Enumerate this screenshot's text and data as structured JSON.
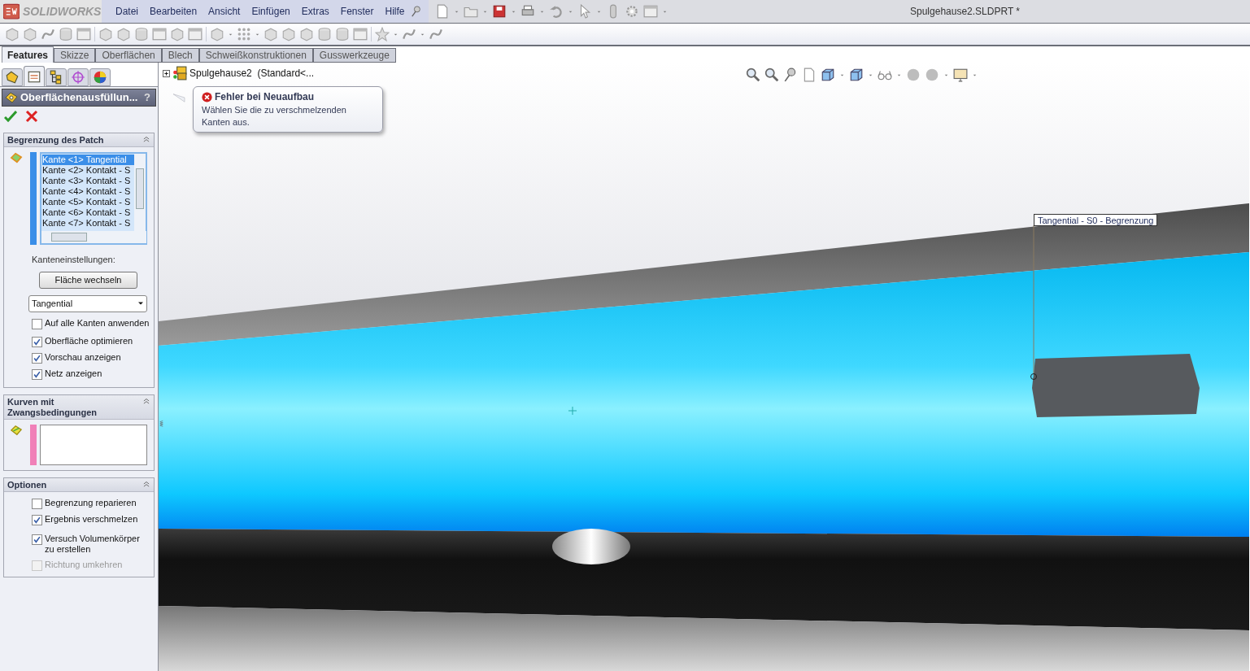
{
  "app": {
    "logo": "SOLIDWORKS",
    "title": "Spulgehause2.SLDPRT *"
  },
  "menu": [
    "Datei",
    "Bearbeiten",
    "Ansicht",
    "Einfügen",
    "Extras",
    "Fenster",
    "Hilfe"
  ],
  "tabs": [
    {
      "label": "Features",
      "selected": true
    },
    {
      "label": "Skizze",
      "selected": false
    },
    {
      "label": "Oberflächen",
      "selected": false
    },
    {
      "label": "Blech",
      "selected": false
    },
    {
      "label": "Schweißkonstruktionen",
      "selected": false
    },
    {
      "label": "Gusswerkzeuge",
      "selected": false
    }
  ],
  "panel_tabs": [
    {
      "selected": false
    },
    {
      "selected": true
    },
    {
      "selected": false
    },
    {
      "selected": false
    },
    {
      "selected": false
    }
  ],
  "property_manager": {
    "title": "Oberflächenausfüllun...",
    "help": "?",
    "sections": [
      {
        "kind": "patch",
        "title": "Begrenzung des Patch",
        "edges": [
          {
            "label": "Kante <1> Tangential",
            "selected": true
          },
          {
            "label": "Kante <2> Kontakt - S",
            "selected": false
          },
          {
            "label": "Kante <3> Kontakt - S",
            "selected": false
          },
          {
            "label": "Kante <4> Kontakt - S",
            "selected": false
          },
          {
            "label": "Kante <5> Kontakt - S",
            "selected": false
          },
          {
            "label": "Kante <6> Kontakt - S",
            "selected": false
          },
          {
            "label": "Kante <7> Kontakt - S",
            "selected": false
          }
        ],
        "settings_label": "Kanteneinstellungen:",
        "button": "Fläche wechseln",
        "dropdown": "Tangential",
        "checkboxes": [
          {
            "label": "Auf alle Kanten anwenden",
            "checked": false,
            "disabled": false
          },
          {
            "label": "Oberfläche optimieren",
            "checked": true,
            "disabled": false
          },
          {
            "label": "Vorschau anzeigen",
            "checked": true,
            "disabled": false
          },
          {
            "label": "Netz anzeigen",
            "checked": true,
            "disabled": false
          }
        ]
      },
      {
        "kind": "curves",
        "title": "Kurven mit Zwangsbedingungen"
      },
      {
        "kind": "options",
        "title": "Optionen",
        "checkboxes": [
          {
            "label": "Begrenzung reparieren",
            "checked": false,
            "disabled": false
          },
          {
            "label": "Ergebnis verschmelzen",
            "checked": true,
            "disabled": false
          },
          {
            "label": "Versuch Volumenkörper zu erstellen",
            "checked": true,
            "disabled": false
          },
          {
            "label": "Richtung umkehren",
            "checked": false,
            "disabled": true
          }
        ]
      }
    ]
  },
  "feature_tree": {
    "root": "Spulgehause2  (Standard<...",
    "expanded": false
  },
  "error_tooltip": {
    "title": "Fehler bei Neuaufbau",
    "message": "Wählen Sie die zu verschmelzenden Kanten aus."
  },
  "viewport": {
    "callout": "Tangential - S0 - Begrenzung"
  }
}
